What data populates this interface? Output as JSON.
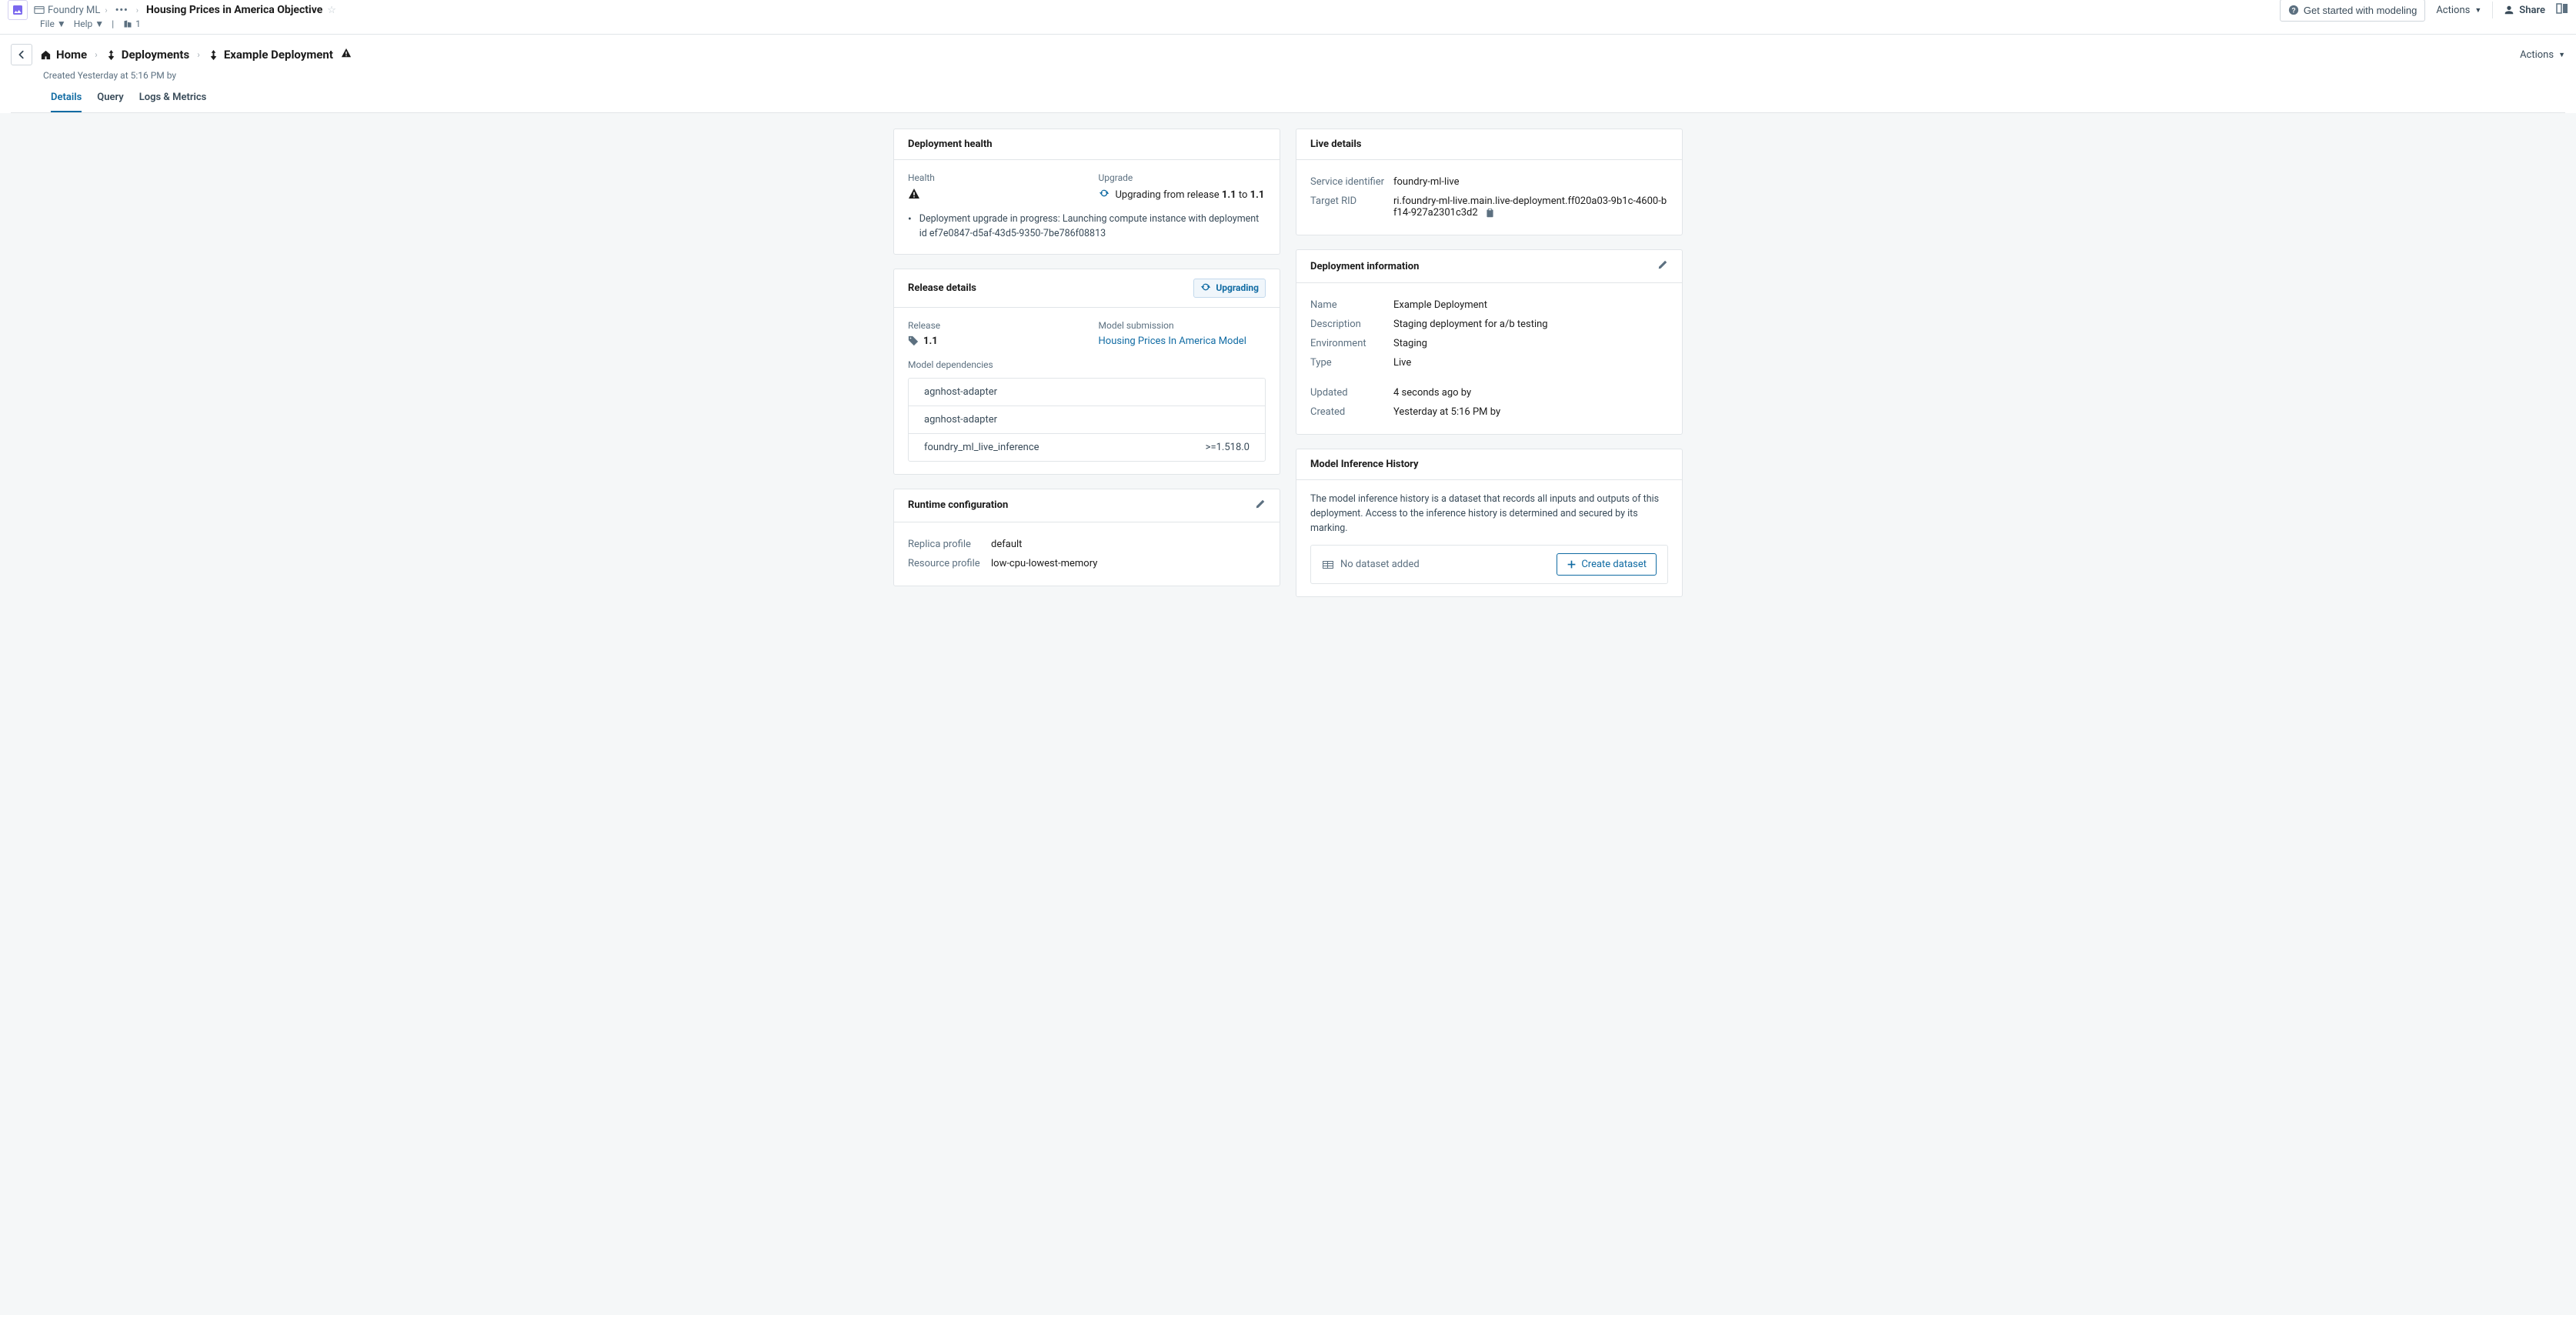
{
  "top": {
    "app_name": "Foundry ML",
    "page_title": "Housing Prices in America Objective",
    "file_menu": "File",
    "help_menu": "Help",
    "org_count": "1",
    "get_started_label": "Get started with modeling",
    "actions_label": "Actions",
    "share_label": "Share"
  },
  "breadcrumbs": {
    "home": "Home",
    "deployments": "Deployments",
    "current": "Example Deployment",
    "created_line": "Created Yesterday at 5:16 PM by",
    "actions_label": "Actions"
  },
  "tabs": {
    "details": "Details",
    "query": "Query",
    "logs": "Logs & Metrics"
  },
  "deployment_health": {
    "title": "Deployment health",
    "health_label": "Health",
    "upgrade_label": "Upgrade",
    "upgrade_prefix": "Upgrading from release ",
    "upgrade_from": "1.1",
    "upgrade_mid": " to ",
    "upgrade_to": "1.1",
    "status_msg": "Deployment upgrade in progress: Launching compute instance with deployment id ef7e0847-d5af-43d5-9350-7be786f08813"
  },
  "release_details": {
    "title": "Release details",
    "upgrading_badge": "Upgrading",
    "release_label": "Release",
    "release_value": "1.1",
    "model_submission_label": "Model submission",
    "model_submission_link": "Housing Prices In America Model",
    "model_deps_label": "Model dependencies",
    "deps": [
      {
        "name": "agnhost-adapter",
        "version": ""
      },
      {
        "name": "agnhost-adapter",
        "version": ""
      },
      {
        "name": "foundry_ml_live_inference",
        "version": ">=1.518.0"
      }
    ]
  },
  "runtime_config": {
    "title": "Runtime configuration",
    "replica_profile_label": "Replica profile",
    "replica_profile_value": "default",
    "resource_profile_label": "Resource profile",
    "resource_profile_value": "low-cpu-lowest-memory"
  },
  "live_details": {
    "title": "Live details",
    "service_id_label": "Service identifier",
    "service_id_value": "foundry-ml-live",
    "target_rid_label": "Target RID",
    "target_rid_value": "ri.foundry-ml-live.main.live-deployment.ff020a03-9b1c-4600-bf14-927a2301c3d2"
  },
  "deployment_info": {
    "title": "Deployment information",
    "name_label": "Name",
    "name_value": "Example Deployment",
    "description_label": "Description",
    "description_value": "Staging deployment for a/b testing",
    "environment_label": "Environment",
    "environment_value": "Staging",
    "type_label": "Type",
    "type_value": "Live",
    "updated_label": "Updated",
    "updated_value": "4 seconds ago by",
    "created_label": "Created",
    "created_value": "Yesterday at 5:16 PM by"
  },
  "model_inference_history": {
    "title": "Model Inference History",
    "desc": "The model inference history is a dataset that records all inputs and outputs of this deployment. Access to the inference history is determined and secured by its marking.",
    "no_dataset": "No dataset added",
    "create_label": "Create dataset"
  }
}
